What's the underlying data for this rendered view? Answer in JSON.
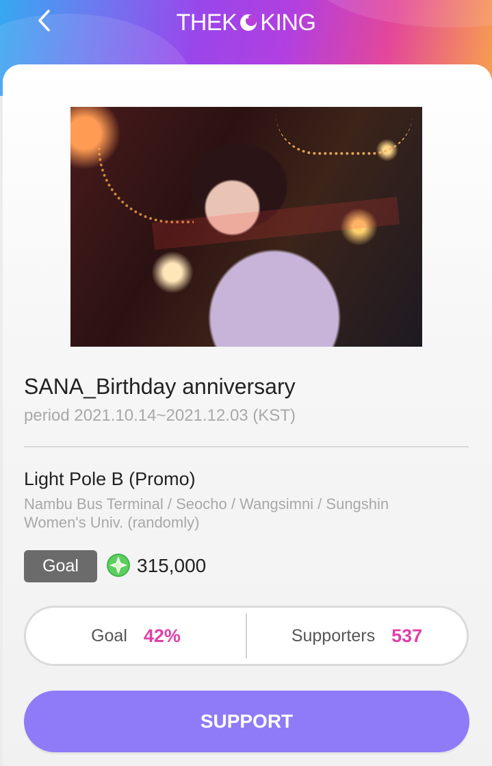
{
  "header": {
    "logo_left": "THEK",
    "logo_right": "KING",
    "back_icon": "chevron-left-icon"
  },
  "event": {
    "title": "SANA_Birthday anniversary",
    "period": "period 2021.10.14~2021.12.03 (KST)",
    "ad_type": "Light Pole B (Promo)",
    "locations": "Nambu Bus Terminal / Seocho / Wangsimni / Sungshin Women's Univ. (randomly)"
  },
  "goal": {
    "tag": "Goal",
    "icon": "star-gem-icon",
    "amount": "315,000"
  },
  "stats": {
    "goal_label": "Goal",
    "goal_value": "42%",
    "supporters_label": "Supporters",
    "supporters_value": "537"
  },
  "actions": {
    "support_label": "SUPPORT"
  },
  "colors": {
    "accent_pink": "#e040a8",
    "button_purple": "#8f7bf7",
    "goal_tag_gray": "#6b6b6b"
  }
}
